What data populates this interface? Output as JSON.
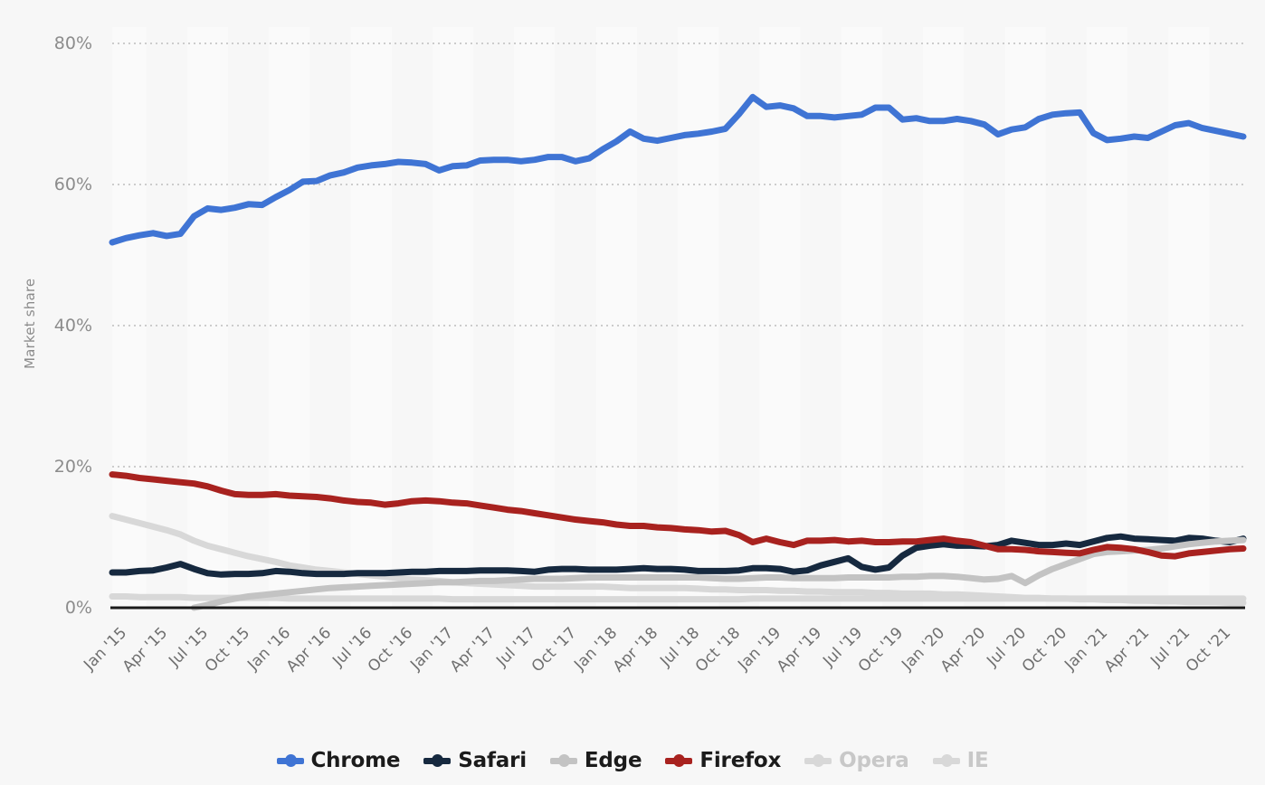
{
  "chart_data": {
    "type": "line",
    "title": "",
    "xlabel": "",
    "ylabel": "Market share",
    "ylim": [
      0,
      80
    ],
    "yticks": [
      0,
      20,
      40,
      60,
      80
    ],
    "ytick_labels": [
      "0%",
      "20%",
      "40%",
      "60%",
      "80%"
    ],
    "grid": "horizontal-dotted",
    "legend_position": "bottom",
    "x_tick_labels": [
      "Jan '15",
      "Apr '15",
      "Jul '15",
      "Oct '15",
      "Jan '16",
      "Apr '16",
      "Jul '16",
      "Oct '16",
      "Jan '17",
      "Apr '17",
      "Jul '17",
      "Oct '17",
      "Jan '18",
      "Apr '18",
      "Jul '18",
      "Oct '18",
      "Jan '19",
      "Apr '19",
      "Jul '19",
      "Oct '19",
      "Jan '20",
      "Apr '20",
      "Jul '20",
      "Oct '20",
      "Jan '21",
      "Apr '21",
      "Jul '21",
      "Oct '21"
    ],
    "x": [
      "Jan '15",
      "Feb '15",
      "Mar '15",
      "Apr '15",
      "May '15",
      "Jun '15",
      "Jul '15",
      "Aug '15",
      "Sep '15",
      "Oct '15",
      "Nov '15",
      "Dec '15",
      "Jan '16",
      "Feb '16",
      "Mar '16",
      "Apr '16",
      "May '16",
      "Jun '16",
      "Jul '16",
      "Aug '16",
      "Sep '16",
      "Oct '16",
      "Nov '16",
      "Dec '16",
      "Jan '17",
      "Feb '17",
      "Mar '17",
      "Apr '17",
      "May '17",
      "Jun '17",
      "Jul '17",
      "Aug '17",
      "Sep '17",
      "Oct '17",
      "Nov '17",
      "Dec '17",
      "Jan '18",
      "Feb '18",
      "Mar '18",
      "Apr '18",
      "May '18",
      "Jun '18",
      "Jul '18",
      "Aug '18",
      "Sep '18",
      "Oct '18",
      "Nov '18",
      "Dec '18",
      "Jan '19",
      "Feb '19",
      "Mar '19",
      "Apr '19",
      "May '19",
      "Jun '19",
      "Jul '19",
      "Aug '19",
      "Sep '19",
      "Oct '19",
      "Nov '19",
      "Dec '19",
      "Jan '20",
      "Feb '20",
      "Mar '20",
      "Apr '20",
      "May '20",
      "Jun '20",
      "Jul '20",
      "Aug '20",
      "Sep '20",
      "Oct '20",
      "Nov '20",
      "Dec '20",
      "Jan '21",
      "Feb '21",
      "Mar '21",
      "Apr '21",
      "May '21",
      "Jun '21",
      "Jul '21",
      "Aug '21",
      "Sep '21",
      "Oct '21",
      "Nov '21",
      "Dec '21"
    ],
    "series": [
      {
        "name": "Chrome",
        "color": "#3f74d4",
        "dimmed": false,
        "values": [
          51.8,
          52.4,
          52.8,
          53.1,
          52.7,
          53.0,
          55.5,
          56.6,
          56.4,
          56.7,
          57.2,
          57.1,
          58.2,
          59.2,
          60.4,
          60.5,
          61.3,
          61.7,
          62.4,
          62.7,
          62.9,
          63.2,
          63.1,
          62.9,
          62.0,
          62.6,
          62.7,
          63.4,
          63.5,
          63.5,
          63.3,
          63.5,
          63.9,
          63.9,
          63.3,
          63.7,
          65.0,
          66.1,
          67.5,
          66.5,
          66.2,
          66.6,
          67.0,
          67.2,
          67.5,
          67.9,
          70.0,
          72.4,
          71.0,
          71.2,
          70.8,
          69.7,
          69.7,
          69.5,
          69.7,
          69.9,
          70.9,
          70.9,
          69.2,
          69.4,
          69.0,
          69.0,
          69.3,
          69.0,
          68.5,
          67.1,
          67.8,
          68.1,
          69.3,
          69.9,
          70.1,
          70.2,
          67.3,
          66.3,
          66.5,
          66.8,
          66.6,
          67.5,
          68.4,
          68.7,
          68.0,
          67.6,
          67.2,
          66.8
        ]
      },
      {
        "name": "Safari",
        "color": "#16293f",
        "dimmed": false,
        "values": [
          5.0,
          5.0,
          5.2,
          5.3,
          5.7,
          6.2,
          5.5,
          4.9,
          4.7,
          4.8,
          4.8,
          4.9,
          5.2,
          5.1,
          4.9,
          4.8,
          4.8,
          4.8,
          4.9,
          4.9,
          4.9,
          5.0,
          5.1,
          5.1,
          5.2,
          5.2,
          5.2,
          5.3,
          5.3,
          5.3,
          5.2,
          5.1,
          5.4,
          5.5,
          5.5,
          5.4,
          5.4,
          5.4,
          5.5,
          5.6,
          5.5,
          5.5,
          5.4,
          5.2,
          5.2,
          5.2,
          5.3,
          5.6,
          5.6,
          5.5,
          5.1,
          5.3,
          6.0,
          6.5,
          7.0,
          5.8,
          5.4,
          5.7,
          7.4,
          8.5,
          8.8,
          9.0,
          8.8,
          8.8,
          8.7,
          8.9,
          9.5,
          9.2,
          8.9,
          8.9,
          9.1,
          8.9,
          9.4,
          9.9,
          10.1,
          9.8,
          9.7,
          9.6,
          9.5,
          9.9,
          9.8,
          9.5,
          9.3,
          9.8
        ]
      },
      {
        "name": "Edge",
        "color": "#c3c3c3",
        "dimmed": false,
        "values": [
          null,
          null,
          null,
          null,
          null,
          null,
          0.0,
          0.4,
          0.9,
          1.3,
          1.6,
          1.8,
          2.0,
          2.2,
          2.4,
          2.6,
          2.8,
          2.9,
          3.0,
          3.1,
          3.2,
          3.3,
          3.4,
          3.5,
          3.6,
          3.6,
          3.7,
          3.8,
          3.8,
          3.9,
          4.0,
          4.1,
          4.1,
          4.1,
          4.2,
          4.3,
          4.3,
          4.3,
          4.3,
          4.3,
          4.3,
          4.3,
          4.3,
          4.3,
          4.2,
          4.1,
          4.1,
          4.2,
          4.3,
          4.3,
          4.2,
          4.2,
          4.2,
          4.2,
          4.3,
          4.3,
          4.3,
          4.3,
          4.4,
          4.4,
          4.5,
          4.5,
          4.4,
          4.2,
          4.0,
          4.1,
          4.5,
          3.5,
          4.6,
          5.5,
          6.2,
          6.9,
          7.6,
          7.9,
          8.0,
          8.1,
          8.2,
          8.4,
          8.7,
          9.0,
          9.2,
          9.4,
          9.5,
          9.6
        ]
      },
      {
        "name": "Firefox",
        "color": "#a8221f",
        "dimmed": false,
        "values": [
          18.9,
          18.7,
          18.4,
          18.2,
          18.0,
          17.8,
          17.6,
          17.2,
          16.6,
          16.1,
          16.0,
          16.0,
          16.1,
          15.9,
          15.8,
          15.7,
          15.5,
          15.2,
          15.0,
          14.9,
          14.6,
          14.8,
          15.1,
          15.2,
          15.1,
          14.9,
          14.8,
          14.5,
          14.2,
          13.9,
          13.7,
          13.4,
          13.1,
          12.8,
          12.5,
          12.3,
          12.1,
          11.8,
          11.6,
          11.6,
          11.4,
          11.3,
          11.1,
          11.0,
          10.8,
          10.9,
          10.3,
          9.3,
          9.8,
          9.3,
          8.9,
          9.5,
          9.5,
          9.6,
          9.4,
          9.5,
          9.3,
          9.3,
          9.4,
          9.4,
          9.6,
          9.8,
          9.5,
          9.3,
          8.8,
          8.3,
          8.3,
          8.2,
          8.0,
          7.9,
          7.8,
          7.7,
          8.2,
          8.6,
          8.5,
          8.3,
          7.9,
          7.4,
          7.3,
          7.7,
          7.9,
          8.1,
          8.3,
          8.4
        ]
      },
      {
        "name": "Opera",
        "color": "#d8d8d8",
        "dimmed": true,
        "values": [
          1.6,
          1.6,
          1.5,
          1.5,
          1.5,
          1.5,
          1.4,
          1.4,
          1.4,
          1.4,
          1.4,
          1.4,
          1.4,
          1.3,
          1.3,
          1.3,
          1.3,
          1.3,
          1.3,
          1.3,
          1.3,
          1.3,
          1.3,
          1.3,
          1.3,
          1.2,
          1.2,
          1.2,
          1.2,
          1.2,
          1.2,
          1.2,
          1.2,
          1.2,
          1.2,
          1.2,
          1.2,
          1.2,
          1.2,
          1.2,
          1.2,
          1.2,
          1.2,
          1.2,
          1.2,
          1.2,
          1.2,
          1.3,
          1.3,
          1.3,
          1.3,
          1.3,
          1.3,
          1.3,
          1.3,
          1.3,
          1.3,
          1.3,
          1.3,
          1.3,
          1.3,
          1.3,
          1.3,
          1.3,
          1.3,
          1.3,
          1.3,
          1.3,
          1.3,
          1.3,
          1.3,
          1.3,
          1.3,
          1.3,
          1.3,
          1.3,
          1.3,
          1.3,
          1.3,
          1.3,
          1.3,
          1.3,
          1.3,
          1.3
        ]
      },
      {
        "name": "IE",
        "color": "#d8d8d8",
        "dimmed": true,
        "values": [
          13.0,
          12.5,
          12.0,
          11.5,
          11.0,
          10.4,
          9.5,
          8.8,
          8.3,
          7.8,
          7.3,
          6.9,
          6.5,
          6.0,
          5.7,
          5.4,
          5.2,
          5.0,
          4.8,
          4.6,
          4.4,
          4.2,
          4.0,
          3.9,
          3.8,
          3.6,
          3.5,
          3.4,
          3.3,
          3.2,
          3.1,
          3.0,
          3.0,
          3.0,
          3.0,
          3.0,
          3.0,
          2.9,
          2.8,
          2.8,
          2.8,
          2.8,
          2.8,
          2.7,
          2.6,
          2.6,
          2.5,
          2.5,
          2.5,
          2.4,
          2.4,
          2.3,
          2.3,
          2.2,
          2.2,
          2.2,
          2.1,
          2.1,
          2.0,
          2.0,
          2.0,
          1.9,
          1.9,
          1.8,
          1.7,
          1.6,
          1.5,
          1.4,
          1.4,
          1.3,
          1.3,
          1.2,
          1.2,
          1.1,
          1.1,
          1.0,
          1.0,
          0.9,
          0.9,
          0.8,
          0.8,
          0.8,
          0.7,
          0.7
        ]
      }
    ]
  },
  "legend": {
    "items": [
      {
        "label": "Chrome"
      },
      {
        "label": "Safari"
      },
      {
        "label": "Edge"
      },
      {
        "label": "Firefox"
      },
      {
        "label": "Opera"
      },
      {
        "label": "IE"
      }
    ]
  },
  "style": {
    "page_background": "#f7f7f7",
    "band_color": "#fafafa",
    "gridline_color": "#cccccc",
    "baseline_color": "#1a1a1a",
    "tick_text_color": "#8c8c8c",
    "xtick_text_color": "#6f6f6f"
  }
}
